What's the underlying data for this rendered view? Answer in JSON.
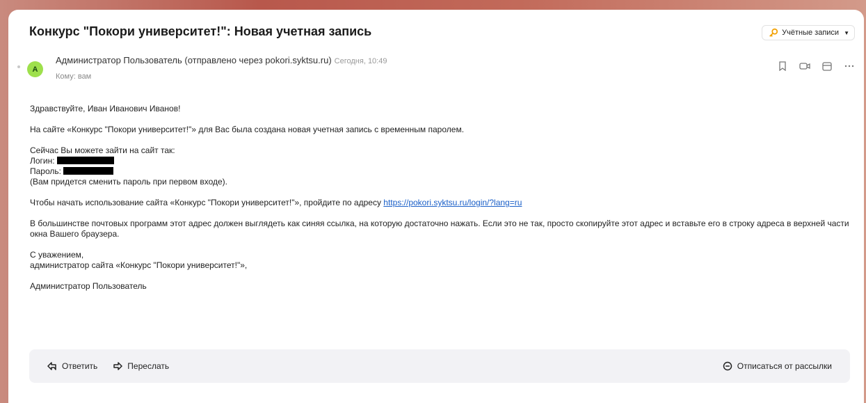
{
  "email": {
    "subject": "Конкурс \"Покори университет!\": Новая учетная запись",
    "accounts_button": "Учётные записи",
    "avatar_letter": "A",
    "sender": "Администратор Пользователь (отправлено через pokori.syktsu.ru)",
    "time": "Сегодня, 10:49",
    "to_label": "Кому:",
    "to_value": "вам"
  },
  "body": {
    "greeting": "Здравствуйте, Иван Иванович Иванов!",
    "intro": "На сайте «Конкурс \"Покори университет!\"» для Вас была создана новая учетная запись с временным паролем.",
    "login_intro": "Сейчас Вы можете зайти на сайт так:",
    "login_label": "Логин:",
    "password_label": "Пароль:",
    "change_note": "(Вам придется сменить пароль при первом входе).",
    "start_text": "Чтобы начать использование сайта «Конкурс \"Покори университет!\"», пройдите по адресу",
    "link": "https://pokori.syktsu.ru/login/?lang=ru",
    "hint": "В большинстве почтовых программ этот адрес должен выглядеть как синяя ссылка, на которую достаточно нажать. Если это не так, просто скопируйте этот адрес и вставьте его в строку адреса в верхней части окна Вашего браузера.",
    "regards": "С уважением,",
    "signature": "администратор сайта «Конкурс \"Покори университет!\"»,",
    "admin_name": "Администратор Пользователь"
  },
  "actions": {
    "reply": "Ответить",
    "forward": "Переслать",
    "unsubscribe": "Отписаться от рассылки"
  },
  "icons": {
    "accounts": "key-icon",
    "bookmark": "bookmark-icon",
    "video": "video-icon",
    "calendar": "calendar-icon",
    "more": "more-icon",
    "reply": "reply-icon",
    "forward": "forward-icon",
    "unsubscribe": "minus-circle-icon"
  },
  "colors": {
    "accent_link": "#1a5fc8",
    "avatar_bg": "#9ee04c",
    "key_orange": "#f2a000"
  }
}
